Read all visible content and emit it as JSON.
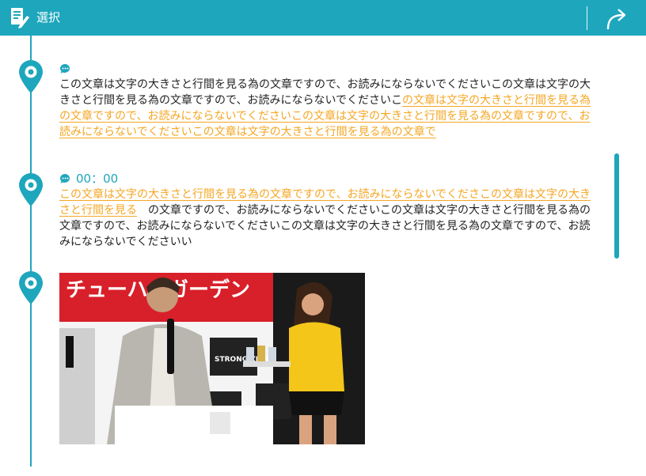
{
  "colors": {
    "accent": "#1ea6bd",
    "highlight": "#f5a623",
    "text": "#222222"
  },
  "header": {
    "title": "選択",
    "left_icon": "document-edit-icon",
    "right_icon": "share-arrow-icon"
  },
  "entries": [
    {
      "icon": "chat-bubble-icon",
      "time": "",
      "text_plain": "この文章は文字の大きさと行間を見る為の文章ですので、お読みにならないでくださいこの文章は文字の大きさと行間を見る為の文章ですので、お読みにならないでくださいこ",
      "text_highlight": "の文章は文字の大きさと行間を見る為の文章ですので、お読みにならないでくださいこの文章は文字の大きさと行間を見る為の文章ですので、お読みにならないでくださいこの文章は文字の大きさと行間を見る為の文章で"
    },
    {
      "icon": "chat-bubble-icon",
      "time": "00：00",
      "text_highlight": "この文章は文字の大きさと行間を見る為の文章ですので、お読みにならないでくださこの文章は文字の大きさと行間を見る",
      "text_plain": "　の文章ですので、お読みにならないでくださいこの文章は文字の大きさと行間を見る為の文章ですので、お読みにならないでくださいこの文章は文字の大きさと行間を見る為の文章ですので、お読みにならないでくださいい"
    },
    {
      "icon": "photo",
      "image": {
        "banner_text": "チューハイガーデン",
        "product_text": "STRONG ZERO"
      }
    }
  ],
  "pin_icon": "location-pin-icon"
}
